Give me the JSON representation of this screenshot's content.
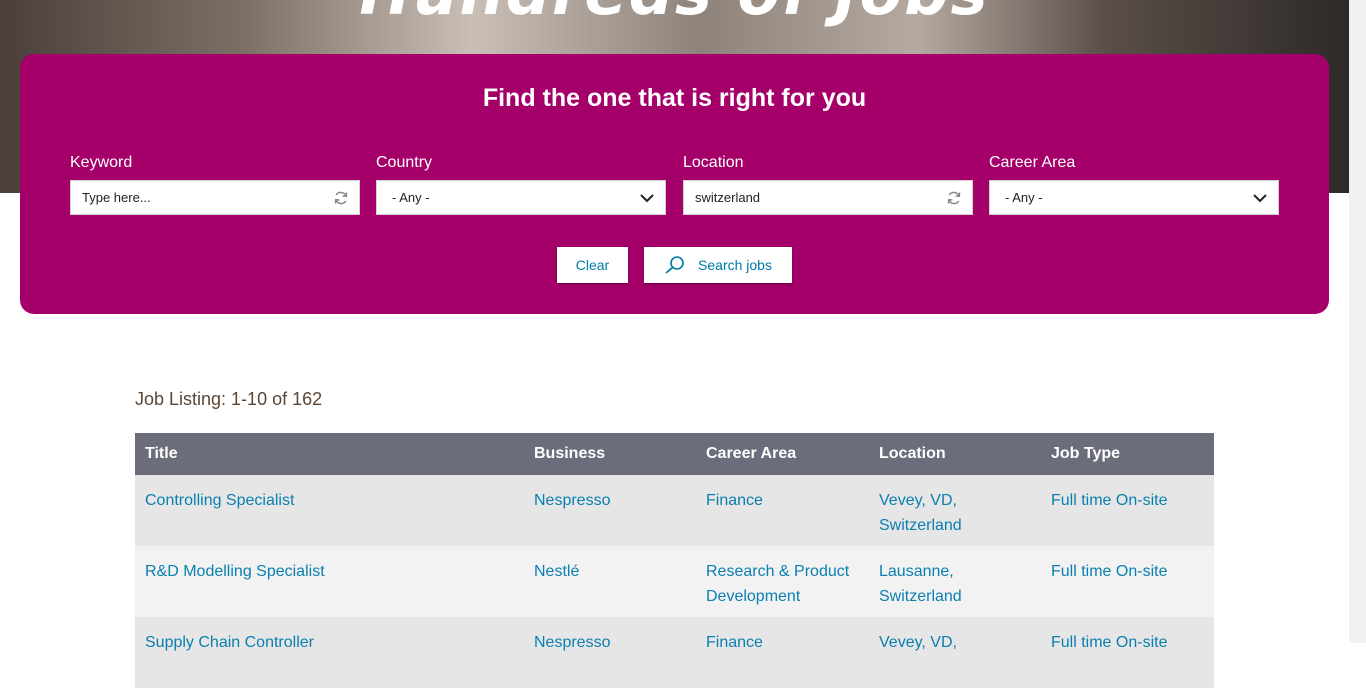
{
  "hero": {
    "title": "Hundreds of Jobs"
  },
  "search": {
    "heading": "Find the one that is right for you",
    "keyword": {
      "label": "Keyword",
      "placeholder": "Type here...",
      "value": ""
    },
    "country": {
      "label": "Country",
      "value": "- Any -"
    },
    "location": {
      "label": "Location",
      "value": "switzerland"
    },
    "career_area": {
      "label": "Career Area",
      "value": "- Any -"
    },
    "clear_label": "Clear",
    "search_label": "Search jobs"
  },
  "listing": {
    "count_text": "Job Listing: 1-10 of 162",
    "columns": [
      "Title",
      "Business",
      "Career Area",
      "Location",
      "Job Type"
    ],
    "rows": [
      {
        "title": "Controlling Specialist",
        "business": "Nespresso",
        "career_area": "Finance",
        "location": "Vevey, VD, Switzerland",
        "job_type": "Full time On-site"
      },
      {
        "title": "R&D Modelling Specialist",
        "business": "Nestlé",
        "career_area": "Research & Product Development",
        "location": "Lausanne, Switzerland",
        "job_type": "Full time On-site"
      },
      {
        "title": "Supply Chain Controller",
        "business": "Nespresso",
        "career_area": "Finance",
        "location": "Vevey, VD,",
        "job_type": "Full time On-site"
      }
    ]
  },
  "colors": {
    "panel": "#a5006a",
    "table_header": "#6b6e7a",
    "link": "#0a7fb0"
  }
}
